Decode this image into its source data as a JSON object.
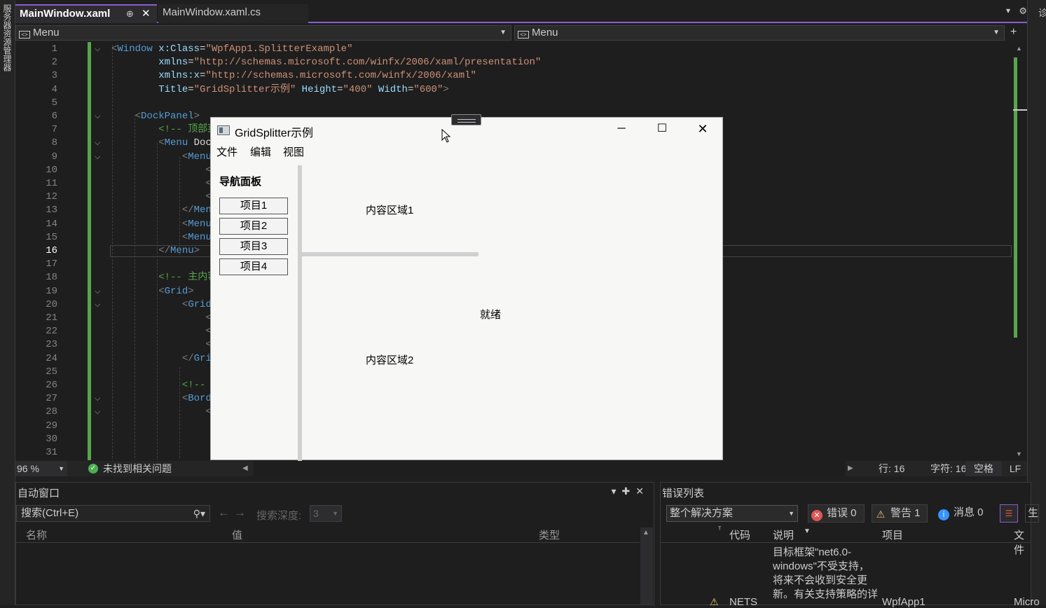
{
  "left_strip": {
    "label": "服务器资源管理器"
  },
  "tabs": [
    {
      "label": "MainWindow.xaml",
      "pin": "⊕",
      "close": "✕"
    },
    {
      "label": "MainWindow.xaml.cs"
    }
  ],
  "tabbar_icons": {
    "dropdown": "▾",
    "settings": "⚙"
  },
  "right_strip": {
    "label": "诊"
  },
  "navbar": {
    "left": "Menu",
    "right": "Menu",
    "split": "+"
  },
  "editor": {
    "current_line": 16,
    "line_numbers": [
      "1",
      "2",
      "3",
      "4",
      "5",
      "6",
      "7",
      "8",
      "9",
      "10",
      "11",
      "12",
      "13",
      "14",
      "15",
      "16",
      "17",
      "18",
      "19",
      "20",
      "21",
      "22",
      "23",
      "24",
      "25",
      "26",
      "27",
      "28",
      "29",
      "30",
      "31"
    ],
    "lines": [
      "<Window x:Class=\"WpfApp1.SplitterExample\"",
      "        xmlns=\"http://schemas.microsoft.com/winfx/2006/xaml/presentation\"",
      "        xmlns:x=\"http://schemas.microsoft.com/winfx/2006/xaml\"",
      "        Title=\"GridSplitter示例\" Height=\"400\" Width=\"600\">",
      "",
      "    <DockPanel>",
      "        <!-- 顶部菜",
      "        <Menu Dock",
      "            <MenuI",
      "                <M",
      "                <M",
      "                <M",
      "            </Menu",
      "            <MenuI",
      "            <MenuI",
      "        </Menu>",
      "",
      "        <!-- 主内容",
      "        <Grid>",
      "            <Grid.",
      "                <C",
      "                <C",
      "                <C",
      "            </Grid",
      "",
      "            <!-- 左",
      "            <Borde",
      "                <S",
      "",
      "",
      ""
    ]
  },
  "status": {
    "zoom": "96 %",
    "issues": "未找到相关问题",
    "line": "行: 16",
    "char": "字符: 16",
    "space": "空格",
    "eol": "LF"
  },
  "auto_panel": {
    "title": "自动窗口",
    "search_placeholder": "搜索(Ctrl+E)",
    "depth_label": "搜索深度:",
    "depth_value": "3",
    "columns": [
      "名称",
      "值",
      "类型"
    ]
  },
  "error_panel": {
    "title": "错误列表",
    "scope": "整个解决方案",
    "errors": "错误 0",
    "warnings": "警告 1",
    "messages": "消息 0",
    "build": "生成",
    "columns": {
      "code": "代码",
      "desc": "说明",
      "project": "项目",
      "file": "文件"
    },
    "row": {
      "code": "NETS",
      "desc": "目标框架\"net6.0-windows\"不受支持，将来不会收到安全更新。有关支持策略的详",
      "project": "WpfApp1",
      "file": "Micro"
    }
  },
  "app_window": {
    "title": "GridSplitter示例",
    "menu": [
      "文件",
      "编辑",
      "视图"
    ],
    "nav_title": "导航面板",
    "nav_items": [
      "项目1",
      "项目2",
      "项目3",
      "项目4"
    ],
    "content1": "内容区域1",
    "content2": "内容区域2",
    "status": "就绪"
  },
  "colors": {
    "accent": "#8a5cd1",
    "green": "#57a64a",
    "tag": "#569cd6",
    "attr": "#9cdcfe",
    "value": "#ce9178"
  }
}
